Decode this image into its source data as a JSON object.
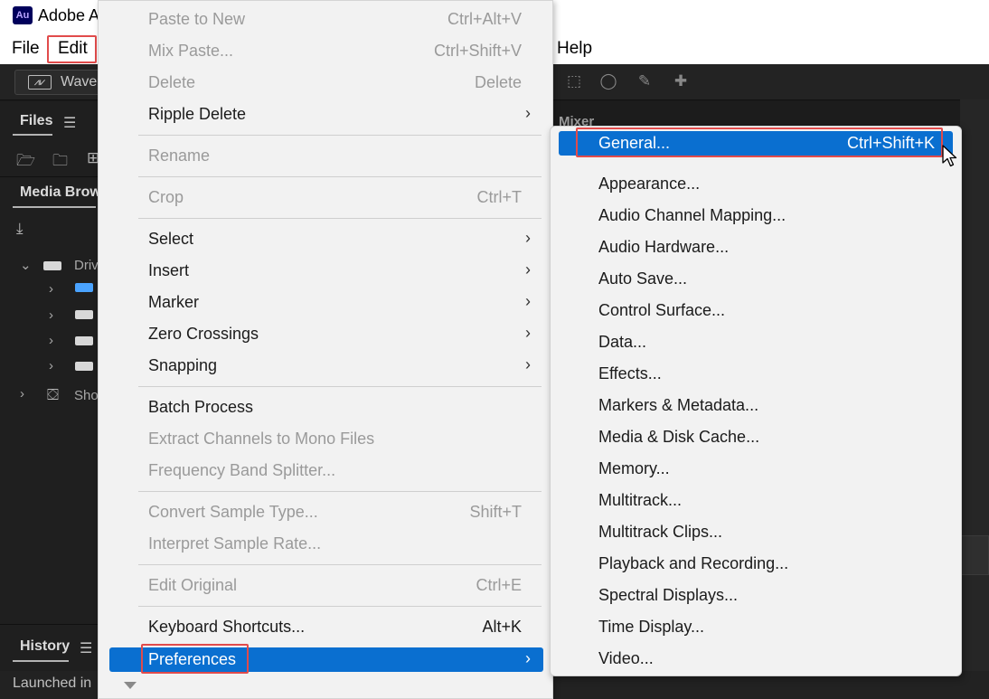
{
  "window": {
    "app_icon_text": "Au",
    "title": "Adobe A"
  },
  "menubar": {
    "file": "File",
    "edit": "Edit",
    "help": "Help"
  },
  "workspace": {
    "waveform_button": "Wave",
    "files_tab": "Files",
    "media_browser_tab": "Media Brow",
    "drives_label": "Driv",
    "shortcuts_label": "Sho",
    "mixer_label": "Mixer",
    "history_tab": "History",
    "status_text": "Launched in"
  },
  "edit_menu": {
    "items": [
      {
        "label": "Paste to New",
        "shortcut": "Ctrl+Alt+V",
        "disabled": true
      },
      {
        "label": "Mix Paste...",
        "shortcut": "Ctrl+Shift+V",
        "disabled": true
      },
      {
        "label": "Delete",
        "shortcut": "Delete",
        "disabled": true
      },
      {
        "label": "Ripple Delete",
        "shortcut": "",
        "disabled": false,
        "submenu": true
      },
      {
        "label": "Rename",
        "shortcut": "",
        "disabled": true
      },
      {
        "label": "Crop",
        "shortcut": "Ctrl+T",
        "disabled": true
      },
      {
        "label": "Select",
        "shortcut": "",
        "disabled": false,
        "submenu": true
      },
      {
        "label": "Insert",
        "shortcut": "",
        "disabled": false,
        "submenu": true
      },
      {
        "label": "Marker",
        "shortcut": "",
        "disabled": false,
        "submenu": true
      },
      {
        "label": "Zero Crossings",
        "shortcut": "",
        "disabled": false,
        "submenu": true
      },
      {
        "label": "Snapping",
        "shortcut": "",
        "disabled": false,
        "submenu": true
      },
      {
        "label": "Batch Process",
        "shortcut": "",
        "disabled": false
      },
      {
        "label": "Extract Channels to Mono Files",
        "shortcut": "",
        "disabled": true
      },
      {
        "label": "Frequency Band Splitter...",
        "shortcut": "",
        "disabled": true
      },
      {
        "label": "Convert Sample Type...",
        "shortcut": "Shift+T",
        "disabled": true
      },
      {
        "label": "Interpret Sample Rate...",
        "shortcut": "",
        "disabled": true
      },
      {
        "label": "Edit Original",
        "shortcut": "Ctrl+E",
        "disabled": true
      },
      {
        "label": "Keyboard Shortcuts...",
        "shortcut": "Alt+K",
        "disabled": false
      },
      {
        "label": "Preferences",
        "shortcut": "",
        "disabled": false,
        "submenu": true,
        "selected": true
      }
    ]
  },
  "preferences_submenu": {
    "items": [
      {
        "label": "General...",
        "shortcut": "Ctrl+Shift+K",
        "selected": true
      },
      {
        "label": "Appearance..."
      },
      {
        "label": "Audio Channel Mapping..."
      },
      {
        "label": "Audio Hardware..."
      },
      {
        "label": "Auto Save..."
      },
      {
        "label": "Control Surface..."
      },
      {
        "label": "Data..."
      },
      {
        "label": "Effects..."
      },
      {
        "label": "Markers & Metadata..."
      },
      {
        "label": "Media & Disk Cache..."
      },
      {
        "label": "Memory..."
      },
      {
        "label": "Multitrack..."
      },
      {
        "label": "Multitrack Clips..."
      },
      {
        "label": "Playback and Recording..."
      },
      {
        "label": "Spectral Displays..."
      },
      {
        "label": "Time Display..."
      },
      {
        "label": "Video..."
      }
    ]
  },
  "colors": {
    "selection": "#0a6fd0",
    "highlight_box": "#e14b4b",
    "disabled_text": "#9a9a9a"
  },
  "icons": {
    "submenu_arrow": "chevron-right-icon",
    "cursor": "mouse-pointer-icon"
  }
}
